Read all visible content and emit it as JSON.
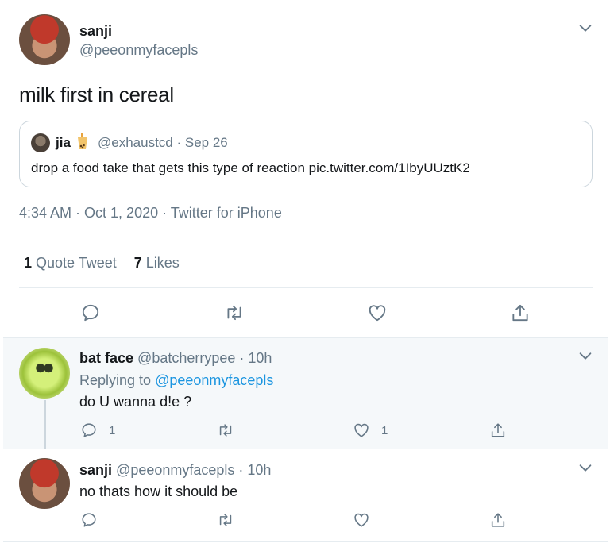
{
  "main_tweet": {
    "author_name": "sanji",
    "author_handle": "@peeonmyfacepls",
    "text": "milk first in cereal",
    "quote": {
      "author_name": "jia",
      "author_emoji": "🧋",
      "handle_date": "@exhaustcd · Sep 26",
      "text": "drop a food take that gets this type of reaction pic.twitter.com/1IbyUUztK2"
    },
    "meta": "4:34 AM · Oct 1, 2020 · Twitter for iPhone",
    "stats": {
      "quote_count": "1",
      "quote_label": " Quote Tweet",
      "like_count": "7",
      "like_label": " Likes"
    },
    "icons": [
      "reply-icon",
      "retweet-icon",
      "like-icon",
      "share-icon",
      "chevron-down-icon"
    ]
  },
  "replies": [
    {
      "author_name": "bat face",
      "handle_time": "@batcherrypee · 10h",
      "replying_prefix": "Replying to ",
      "replying_to": "@peeonmyfacepls",
      "text": "do U wanna d!e ?",
      "reply_count": "1",
      "like_count": "1"
    },
    {
      "author_name": "sanji",
      "handle_time": "@peeonmyfacepls · 10h",
      "text": "no thats how it should be"
    }
  ],
  "colors": {
    "text": "#14171a",
    "secondary": "#657786",
    "link": "#1b95e0",
    "border": "#e6ecf0",
    "reply_bg": "#f5f8fa"
  }
}
